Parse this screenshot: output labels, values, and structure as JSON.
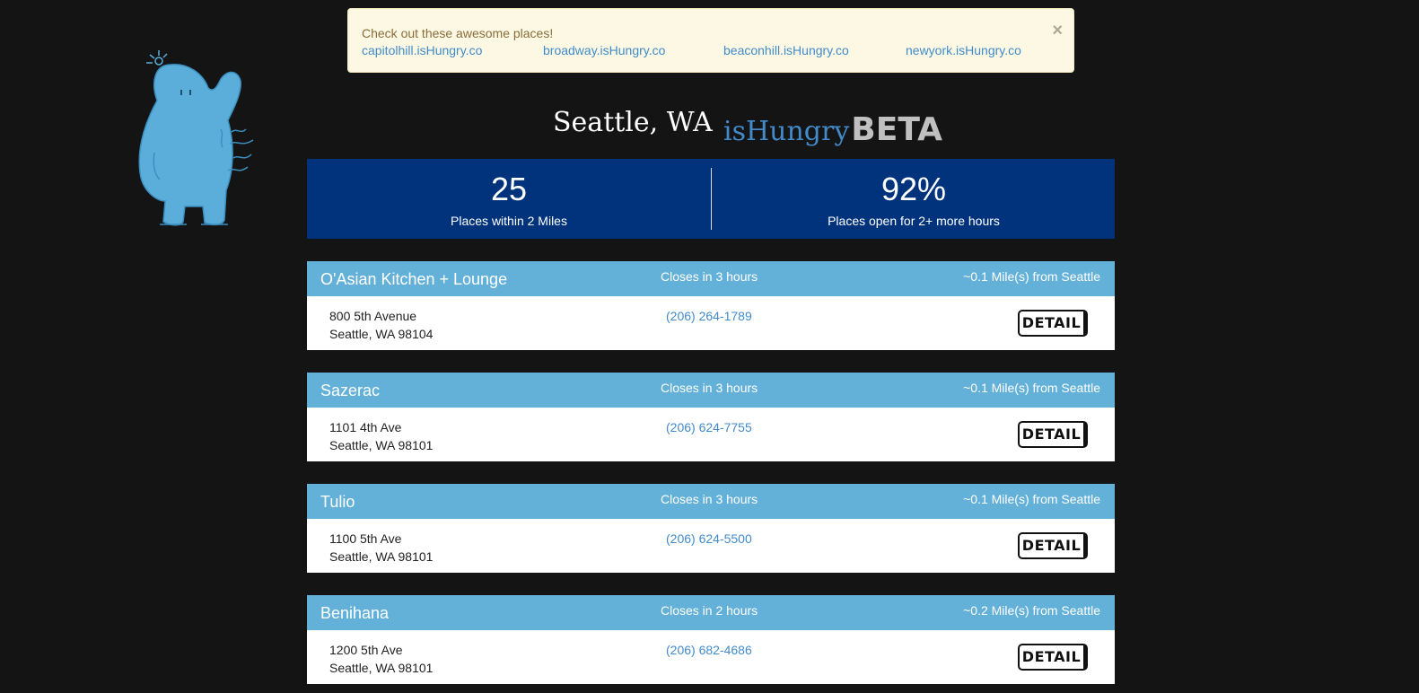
{
  "alert": {
    "message": "Check out these awesome places!",
    "close_glyph": "×",
    "links": [
      {
        "label": "capitolhill.isHungry.co"
      },
      {
        "label": "broadway.isHungry.co"
      },
      {
        "label": "beaconhill.isHungry.co"
      },
      {
        "label": "newyork.isHungry.co"
      }
    ]
  },
  "mascot": {
    "icon": "blue-creature-mascot-icon",
    "color": "#5aaed9"
  },
  "header": {
    "city": "Seattle, WA",
    "brand": "isHungry",
    "tag": "BETA"
  },
  "stats": [
    {
      "value": "25",
      "label": "Places within 2 Miles"
    },
    {
      "value": "92%",
      "label": "Places open for 2+ more hours"
    }
  ],
  "restaurants": [
    {
      "name": "O'Asian Kitchen + Lounge",
      "closes": "Closes in 3 hours",
      "distance": "~0.1 Mile(s) from Seattle",
      "address_line1": "800 5th Avenue",
      "address_line2": "Seattle, WA 98104",
      "phone": "(206) 264-1789",
      "detail_label": "DETAIL"
    },
    {
      "name": "Sazerac",
      "closes": "Closes in 3 hours",
      "distance": "~0.1 Mile(s) from Seattle",
      "address_line1": "1101 4th Ave",
      "address_line2": "Seattle, WA 98101",
      "phone": "(206) 624-7755",
      "detail_label": "DETAIL"
    },
    {
      "name": "Tulio",
      "closes": "Closes in 3 hours",
      "distance": "~0.1 Mile(s) from Seattle",
      "address_line1": "1100 5th Ave",
      "address_line2": "Seattle, WA 98101",
      "phone": "(206) 624-5500",
      "detail_label": "DETAIL"
    },
    {
      "name": "Benihana",
      "closes": "Closes in 2 hours",
      "distance": "~0.2 Mile(s) from Seattle",
      "address_line1": "1200 5th Ave",
      "address_line2": "Seattle, WA 98101",
      "phone": "(206) 682-4686",
      "detail_label": "DETAIL"
    }
  ],
  "colors": {
    "background": "#141414",
    "alert_bg": "#fcf8e3",
    "link": "#428bca",
    "stats_bg": "#00337c",
    "card_header_bg": "#63b1d8"
  }
}
